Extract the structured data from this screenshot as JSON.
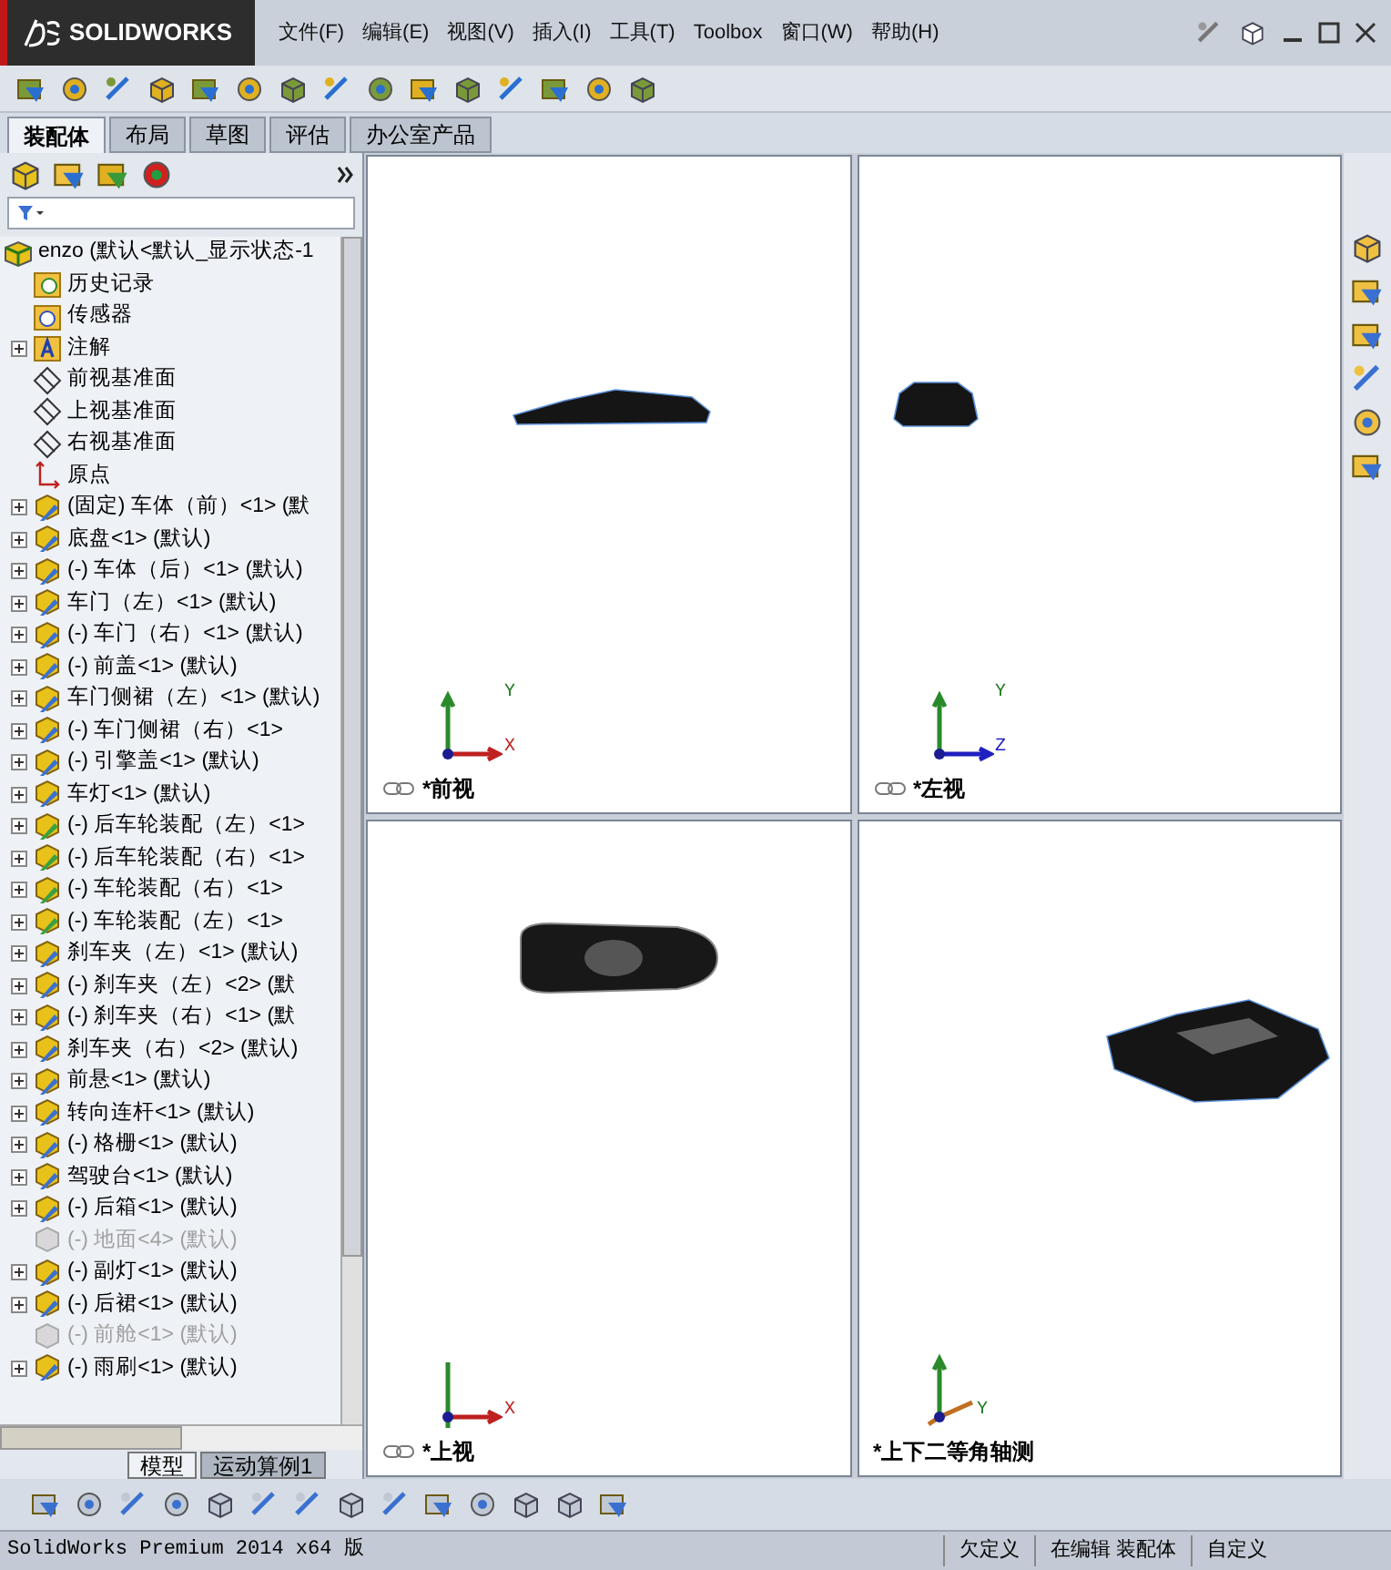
{
  "title_bar": {
    "logo": "SOLIDWORKS",
    "menu": [
      "文件(F)",
      "编辑(E)",
      "视图(V)",
      "插入(I)",
      "工具(T)",
      "Toolbox",
      "窗口(W)",
      "帮助(H)"
    ]
  },
  "command_tabs": [
    {
      "label": "装配体",
      "selected": true
    },
    {
      "label": "布局",
      "selected": false
    },
    {
      "label": "草图",
      "selected": false
    },
    {
      "label": "评估",
      "selected": false
    },
    {
      "label": "办公室产品",
      "selected": false
    }
  ],
  "tree": {
    "items": [
      {
        "kind": "root",
        "label": "enzo  (默认<默认_显示状态-1"
      },
      {
        "kind": "history",
        "label": "历史记录"
      },
      {
        "kind": "sensor",
        "label": "传感器"
      },
      {
        "kind": "annotation",
        "label": "注解"
      },
      {
        "kind": "plane",
        "label": "前视基准面"
      },
      {
        "kind": "plane",
        "label": "上视基准面"
      },
      {
        "kind": "plane",
        "label": "右视基准面"
      },
      {
        "kind": "origin",
        "label": "原点"
      },
      {
        "kind": "component",
        "label": "(固定) 车体（前）<1> (默",
        "suppressed": false
      },
      {
        "kind": "component",
        "label": "底盘<1> (默认)",
        "suppressed": false
      },
      {
        "kind": "component",
        "label": "(-) 车体（后）<1> (默认)",
        "suppressed": false
      },
      {
        "kind": "component",
        "label": "车门（左）<1> (默认)",
        "suppressed": false
      },
      {
        "kind": "component",
        "label": "(-) 车门（右）<1> (默认)",
        "suppressed": false
      },
      {
        "kind": "component",
        "label": "(-) 前盖<1> (默认)",
        "suppressed": false
      },
      {
        "kind": "component",
        "label": "车门侧裙（左）<1> (默认)",
        "suppressed": false
      },
      {
        "kind": "component",
        "label": "(-) 车门侧裙（右）<1>",
        "suppressed": false
      },
      {
        "kind": "component",
        "label": "(-) 引擎盖<1> (默认)",
        "suppressed": false
      },
      {
        "kind": "component",
        "label": "车灯<1> (默认)",
        "suppressed": false
      },
      {
        "kind": "subassembly",
        "label": "(-) 后车轮装配（左）<1>",
        "suppressed": false
      },
      {
        "kind": "subassembly",
        "label": "(-) 后车轮装配（右）<1>",
        "suppressed": false
      },
      {
        "kind": "subassembly",
        "label": "(-) 车轮装配（右）<1>",
        "suppressed": false
      },
      {
        "kind": "subassembly",
        "label": "(-) 车轮装配（左）<1>",
        "suppressed": false
      },
      {
        "kind": "component",
        "label": "刹车夹（左）<1> (默认)",
        "suppressed": false
      },
      {
        "kind": "component",
        "label": "(-) 刹车夹（左）<2> (默",
        "suppressed": false
      },
      {
        "kind": "component",
        "label": "(-) 刹车夹（右）<1> (默",
        "suppressed": false
      },
      {
        "kind": "component",
        "label": "刹车夹（右）<2> (默认)",
        "suppressed": false
      },
      {
        "kind": "component",
        "label": "前悬<1> (默认)",
        "suppressed": false
      },
      {
        "kind": "component",
        "label": "转向连杆<1> (默认)",
        "suppressed": false
      },
      {
        "kind": "component",
        "label": "(-) 格栅<1> (默认)",
        "suppressed": false
      },
      {
        "kind": "component",
        "label": "驾驶台<1> (默认)",
        "suppressed": false
      },
      {
        "kind": "component",
        "label": "(-) 后箱<1> (默认)",
        "suppressed": false
      },
      {
        "kind": "component",
        "label": "(-) 地面<4> (默认)",
        "suppressed": true
      },
      {
        "kind": "component",
        "label": "(-) 副灯<1> (默认)",
        "suppressed": false
      },
      {
        "kind": "component",
        "label": "(-) 后裙<1> (默认)",
        "suppressed": false
      },
      {
        "kind": "component",
        "label": "(-) 前舱<1> (默认)",
        "suppressed": true
      },
      {
        "kind": "component",
        "label": "(-) 雨刷<1> (默认)",
        "suppressed": false
      }
    ]
  },
  "viewports": [
    {
      "kind": "front",
      "label": "*前视",
      "linked": true,
      "axes": [
        "Y",
        "X"
      ]
    },
    {
      "kind": "left",
      "label": "*左视",
      "linked": true,
      "axes": [
        "Y",
        "Z"
      ]
    },
    {
      "kind": "top",
      "label": "*上视",
      "linked": true,
      "axes": [
        "X"
      ]
    },
    {
      "kind": "iso",
      "label": "*上下二等角轴测",
      "linked": false,
      "axes": [
        "Y"
      ]
    }
  ],
  "bottom_tabs": [
    {
      "label": "模型",
      "selected": true
    },
    {
      "label": "运动算例1",
      "selected": false
    }
  ],
  "status_bar": {
    "product": "SolidWorks Premium 2014 x64 版",
    "fields": [
      "欠定义",
      "在编辑 装配体",
      "自定义"
    ]
  }
}
